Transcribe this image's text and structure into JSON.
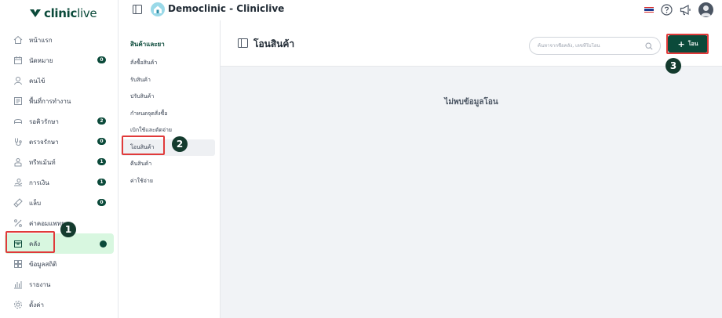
{
  "brand": {
    "name_bold": "clinic",
    "name_light": "live"
  },
  "header": {
    "clinic_name": "Democlinic - Cliniclive"
  },
  "sidebar": {
    "items": [
      {
        "label": "หน้าแรก",
        "icon": "home-icon",
        "badge": ""
      },
      {
        "label": "นัดหมาย",
        "icon": "calendar-icon",
        "badge": "0"
      },
      {
        "label": "คนไข้",
        "icon": "user-icon",
        "badge": ""
      },
      {
        "label": "พื้นที่การทำงาน",
        "icon": "workspace-icon",
        "badge": ""
      },
      {
        "label": "รอคิวรักษา",
        "icon": "queue-icon",
        "badge": "2"
      },
      {
        "label": "ตรวจรักษา",
        "icon": "stethoscope-icon",
        "badge": "0"
      },
      {
        "label": "ทรีทเม้นท์",
        "icon": "treatment-icon",
        "badge": "1"
      },
      {
        "label": "การเงิน",
        "icon": "finance-icon",
        "badge": "1"
      },
      {
        "label": "แล็บ",
        "icon": "lab-icon",
        "badge": "0"
      },
      {
        "label": "ค่าคอมแพทย",
        "icon": "percent-icon",
        "badge": ""
      },
      {
        "label": "คลัง",
        "icon": "inventory-icon",
        "badge": ""
      },
      {
        "label": "ข้อมูลสถิติ",
        "icon": "stats-icon",
        "badge": ""
      },
      {
        "label": "รายงาน",
        "icon": "report-icon",
        "badge": ""
      },
      {
        "label": "ตั้งค่า",
        "icon": "settings-icon",
        "badge": ""
      }
    ]
  },
  "submenu": {
    "title": "สินค้าและยา",
    "items": [
      "สั่งซื้อสินค้า",
      "รับสินค้า",
      "ปรับสินค้า",
      "กำหนดจุดสั่งซื้อ",
      "เบิกใช้และตัดจ่าย",
      "โอนสินค้า",
      "คืนสินค้า",
      "ค่าใช้จ่าย"
    ]
  },
  "main": {
    "title": "โอนสินค้า",
    "search_placeholder": "ค้นหาจากชื่อคลัง, เลขที่ใบโอน",
    "add_label": "โอน",
    "empty_message": "ไม่พบข้อมูลโอน"
  },
  "steps": [
    "1",
    "2",
    "3"
  ],
  "colors": {
    "brand": "#0b4a3a",
    "active_bg": "#d8f7e0",
    "highlight": "#e03a3a"
  }
}
